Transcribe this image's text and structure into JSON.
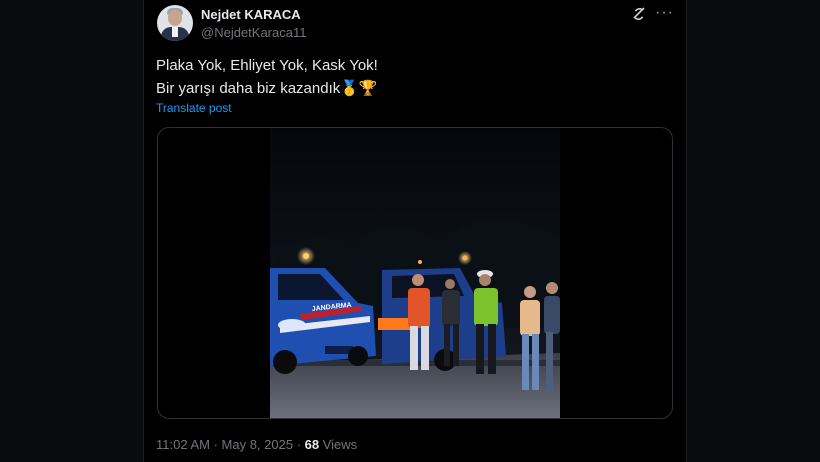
{
  "author": {
    "name": "Nejdet KARACA",
    "handle": "@NejdetKaraca11"
  },
  "tweet": {
    "line1": "Plaka Yok, Ehliyet Yok, Kask Yok!",
    "line2": "Bir yarışı daha biz kazandık🥇🏆",
    "translate_label": "Translate post"
  },
  "meta": {
    "time": "11:02 AM",
    "separator": " · ",
    "date": "May 8, 2025",
    "views_count": "68",
    "views_label": " Views"
  },
  "media": {
    "type": "video",
    "police_car_text": "JANDARMA"
  },
  "icons": {
    "top_right": [
      "grok-icon",
      "more-icon"
    ]
  },
  "colors": {
    "background": "#000000",
    "link": "#1d9bf0",
    "secondary_text": "#71767b",
    "jandarma_blue": "#1f4fb0"
  }
}
